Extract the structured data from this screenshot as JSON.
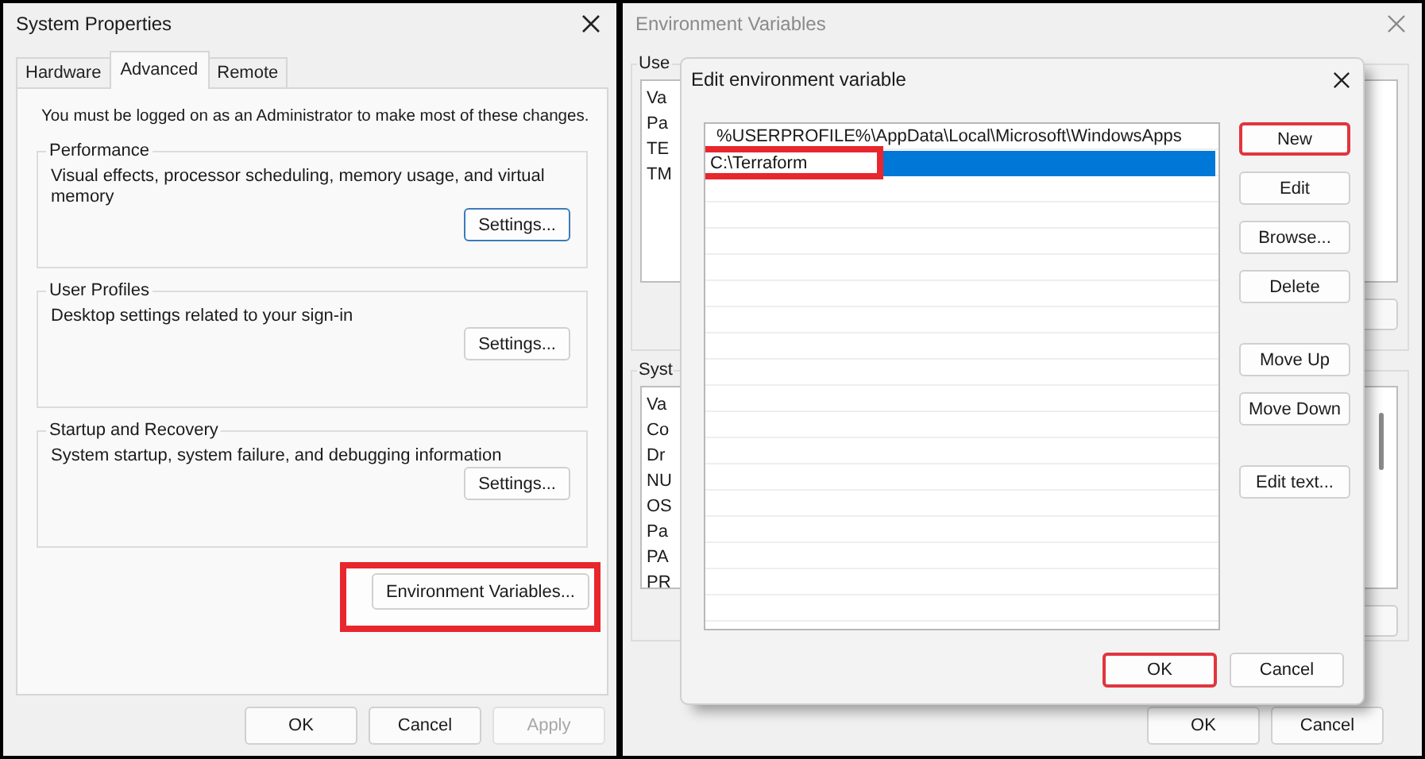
{
  "system_properties": {
    "title": "System Properties",
    "tabs": [
      {
        "label": "Hardware",
        "selected": false
      },
      {
        "label": "Advanced",
        "selected": true
      },
      {
        "label": "Remote",
        "selected": false
      }
    ],
    "notice": "You must be logged on as an Administrator to make most of these changes.",
    "groups": [
      {
        "title": "Performance",
        "description": "Visual effects, processor scheduling, memory usage, and virtual memory",
        "button": "Settings...",
        "focused": true
      },
      {
        "title": "User Profiles",
        "description": "Desktop settings related to your sign-in",
        "button": "Settings...",
        "focused": false
      },
      {
        "title": "Startup and Recovery",
        "description": "System startup, system failure, and debugging information",
        "button": "Settings...",
        "focused": false
      }
    ],
    "env_button": {
      "label": "Environment Variables...",
      "highlighted": true
    },
    "buttons": [
      {
        "label": "OK",
        "disabled": false
      },
      {
        "label": "Cancel",
        "disabled": false
      },
      {
        "label": "Apply",
        "disabled": true
      }
    ]
  },
  "environment_variables": {
    "title": "Environment Variables",
    "user_section": "Use",
    "user_rows": [
      "Va",
      "Pa",
      "TE",
      "TM"
    ],
    "system_section": "Syst",
    "system_rows": [
      "Va",
      "Co",
      "Dr",
      "NU",
      "OS",
      "Pa",
      "PA",
      "PR"
    ],
    "buttons": [
      "OK",
      "Cancel"
    ]
  },
  "edit_dialog": {
    "title": "Edit environment variable",
    "entries": [
      {
        "value": "%USERPROFILE%\\AppData\\Local\\Microsoft\\WindowsApps",
        "selected": false,
        "editing": false,
        "highlighted": false
      },
      {
        "value": "C:\\Terraform",
        "selected": true,
        "editing": true,
        "highlighted": true
      }
    ],
    "side_button_groups": [
      [
        {
          "label": "New",
          "highlighted": true
        },
        {
          "label": "Edit",
          "highlighted": false
        },
        {
          "label": "Browse...",
          "highlighted": false
        },
        {
          "label": "Delete",
          "highlighted": false
        }
      ],
      [
        {
          "label": "Move Up",
          "highlighted": false
        },
        {
          "label": "Move Down",
          "highlighted": false
        }
      ],
      [
        {
          "label": "Edit text...",
          "highlighted": false
        }
      ]
    ],
    "buttons": [
      {
        "label": "OK",
        "highlighted": true
      },
      {
        "label": "Cancel",
        "highlighted": false
      }
    ]
  }
}
